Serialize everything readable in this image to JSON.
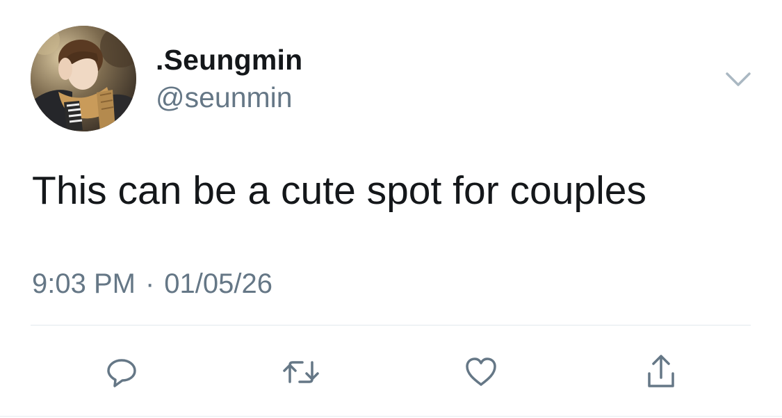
{
  "user": {
    "display_name": ".Seungmin",
    "handle": "@seunmin",
    "avatar_icon": "profile-photo"
  },
  "tweet": {
    "text": "This can be a cute spot for couples",
    "time": "9:03 PM",
    "separator": "·",
    "date": "01/05/26"
  },
  "actions": [
    {
      "name": "reply",
      "icon": "reply-icon"
    },
    {
      "name": "retweet",
      "icon": "retweet-icon"
    },
    {
      "name": "like",
      "icon": "heart-icon"
    },
    {
      "name": "share",
      "icon": "share-icon"
    }
  ],
  "colors": {
    "text_primary": "#14171a",
    "text_secondary": "#657786",
    "icon": "#657786",
    "divider": "#e1e8ed",
    "background": "#ffffff"
  }
}
